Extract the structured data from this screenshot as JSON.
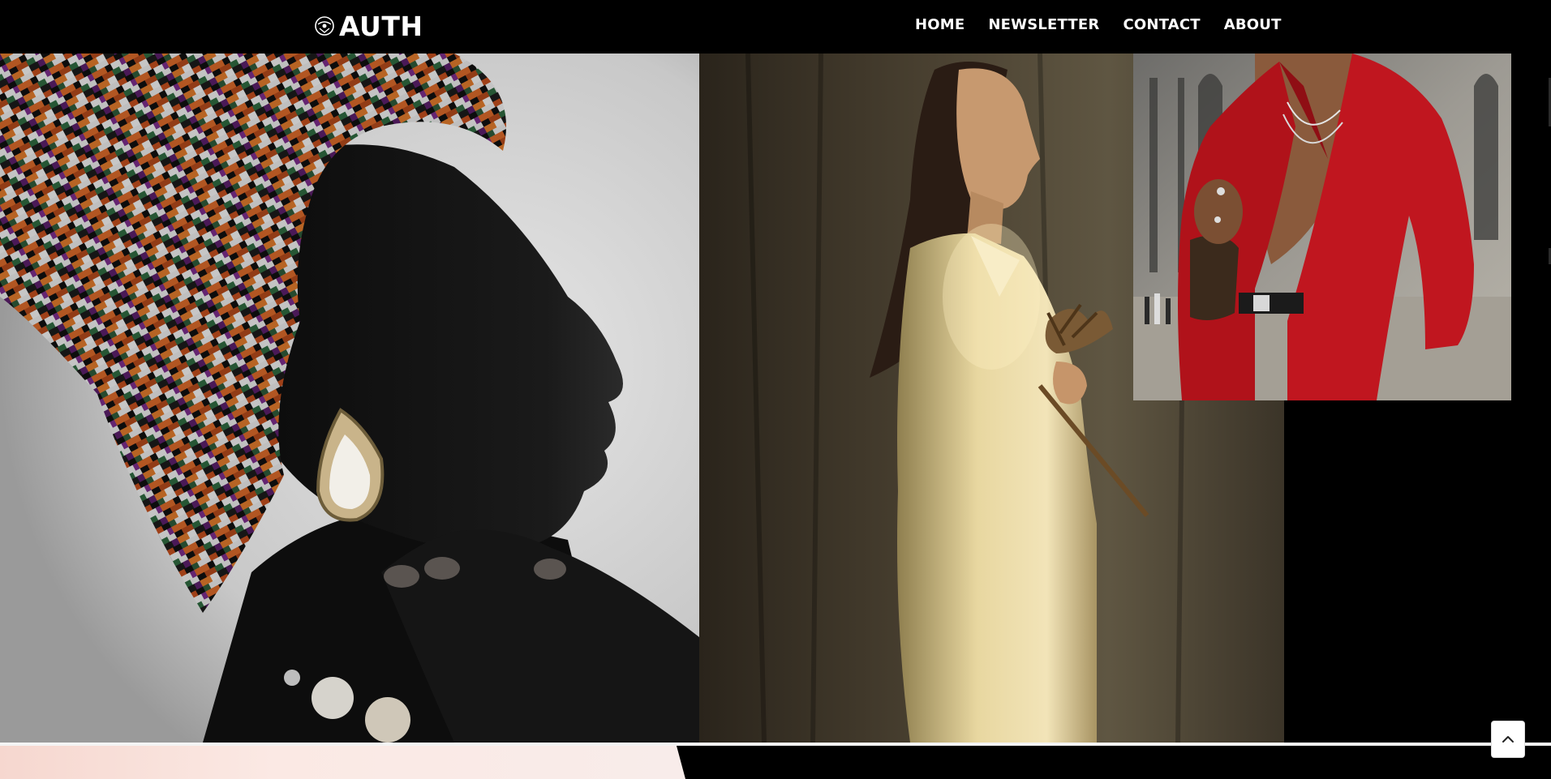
{
  "header": {
    "logo_text": "AUTH",
    "nav": [
      {
        "label": "HOME"
      },
      {
        "label": "NEWSLETTER"
      },
      {
        "label": "CONTACT"
      },
      {
        "label": "ABOUT"
      }
    ]
  },
  "colors": {
    "background": "#000000",
    "nav_text": "#ffffff",
    "accent_red": "#b0121a",
    "suit_cream": "#e8d7a0",
    "strip_pink": "#f6d7cf"
  },
  "icons": {
    "logo": "logo-emblem-icon",
    "back_to_top": "chevron-up-icon"
  }
}
